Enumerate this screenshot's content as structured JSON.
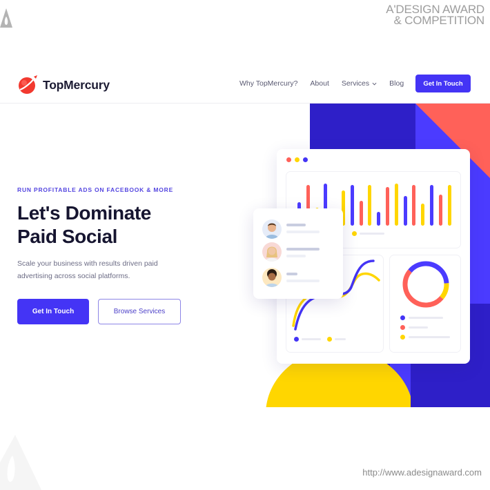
{
  "watermark": {
    "title_line1": "A'DESIGN AWARD",
    "title_line2": "& COMPETITION",
    "url": "http://www.adesignaward.com"
  },
  "header": {
    "brand": "TopMercury",
    "nav": [
      {
        "label": "Why TopMercury?"
      },
      {
        "label": "About"
      },
      {
        "label": "Services",
        "has_dropdown": true
      },
      {
        "label": "Blog"
      }
    ],
    "cta_label": "Get In Touch"
  },
  "hero": {
    "eyebrow": "RUN PROFITABLE ADS ON FACEBOOK & MORE",
    "title_line1": "Let's Dominate",
    "title_line2": "Paid Social",
    "subtitle": "Scale your business with results driven paid advertising across social platforms.",
    "primary_button": "Get In Touch",
    "secondary_button": "Browse Services"
  },
  "colors": {
    "brand_blue": "#4434f5",
    "dark_blue": "#2e1fc8",
    "light_blue": "#4b3bff",
    "coral": "#ff6159",
    "yellow": "#ffd600",
    "text_dark": "#161530"
  },
  "illustration": {
    "window_dots": [
      "#ff6159",
      "#ffd600",
      "#4434f5"
    ],
    "bars": [
      {
        "color": "blue",
        "value": 0.55
      },
      {
        "color": "coral",
        "value": 0.95
      },
      {
        "color": "yellow",
        "value": 0.42
      },
      {
        "color": "blue",
        "value": 0.98
      },
      {
        "color": "coral",
        "value": 0.36
      },
      {
        "color": "yellow",
        "value": 0.83
      },
      {
        "color": "blue",
        "value": 0.95
      },
      {
        "color": "coral",
        "value": 0.58
      },
      {
        "color": "yellow",
        "value": 0.95
      },
      {
        "color": "blue",
        "value": 0.32
      },
      {
        "color": "coral",
        "value": 0.9
      },
      {
        "color": "yellow",
        "value": 0.98
      },
      {
        "color": "blue",
        "value": 0.69
      },
      {
        "color": "coral",
        "value": 0.95
      },
      {
        "color": "yellow",
        "value": 0.51
      },
      {
        "color": "blue",
        "value": 0.95
      },
      {
        "color": "coral",
        "value": 0.72
      },
      {
        "color": "yellow",
        "value": 0.95
      }
    ],
    "donut_segments": [
      {
        "color": "blue",
        "fraction": 0.38
      },
      {
        "color": "yellow",
        "fraction": 0.12
      },
      {
        "color": "coral",
        "fraction": 0.5
      }
    ],
    "people": [
      "avatar-man",
      "avatar-woman",
      "avatar-man-curly"
    ]
  }
}
